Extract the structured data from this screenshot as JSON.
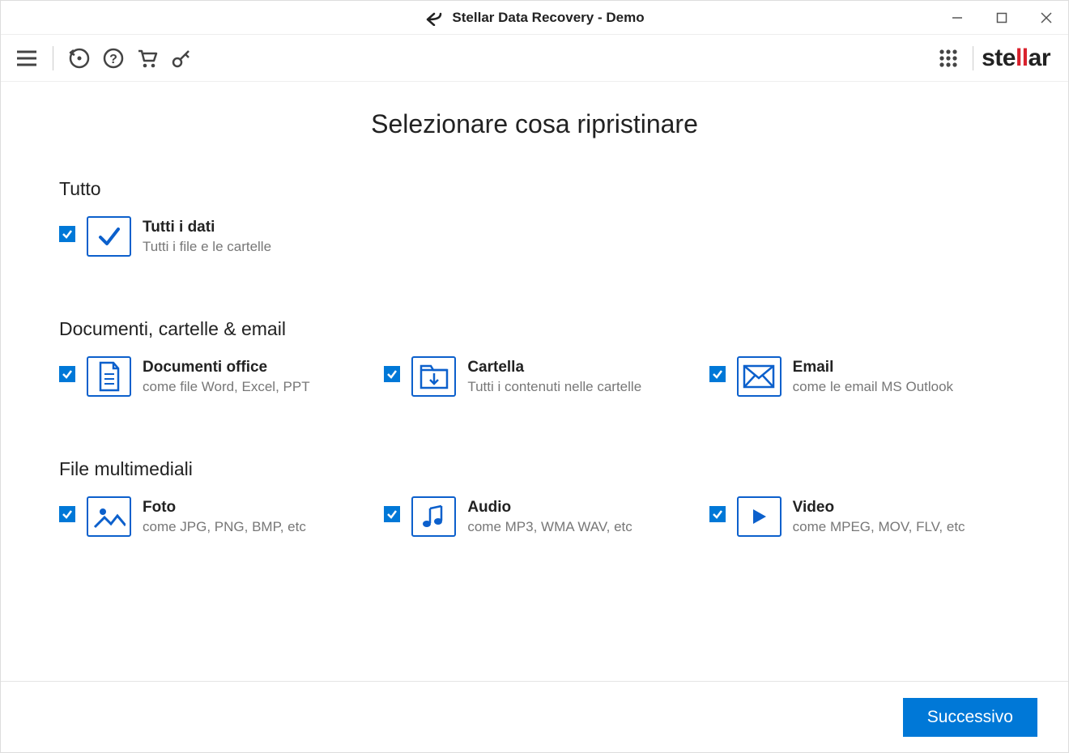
{
  "window": {
    "title": "Stellar Data Recovery - Demo"
  },
  "brand": {
    "pre": "ste",
    "red": "ll",
    "post": "ar"
  },
  "page": {
    "heading": "Selezionare cosa ripristinare"
  },
  "sections": {
    "all": {
      "title": "Tutto"
    },
    "docs": {
      "title": "Documenti, cartelle & email"
    },
    "media": {
      "title": "File multimediali"
    }
  },
  "options": {
    "all_data": {
      "title": "Tutti i dati",
      "sub": "Tutti i file e le cartelle"
    },
    "office": {
      "title": "Documenti office",
      "sub": "come file Word, Excel, PPT"
    },
    "folder": {
      "title": "Cartella",
      "sub": "Tutti i contenuti nelle cartelle"
    },
    "email": {
      "title": "Email",
      "sub": "come le email MS Outlook"
    },
    "photo": {
      "title": "Foto",
      "sub": "come JPG, PNG, BMP, etc"
    },
    "audio": {
      "title": "Audio",
      "sub": "come MP3, WMA WAV, etc"
    },
    "video": {
      "title": "Video",
      "sub": "come MPEG, MOV, FLV, etc"
    }
  },
  "footer": {
    "next": "Successivo"
  }
}
